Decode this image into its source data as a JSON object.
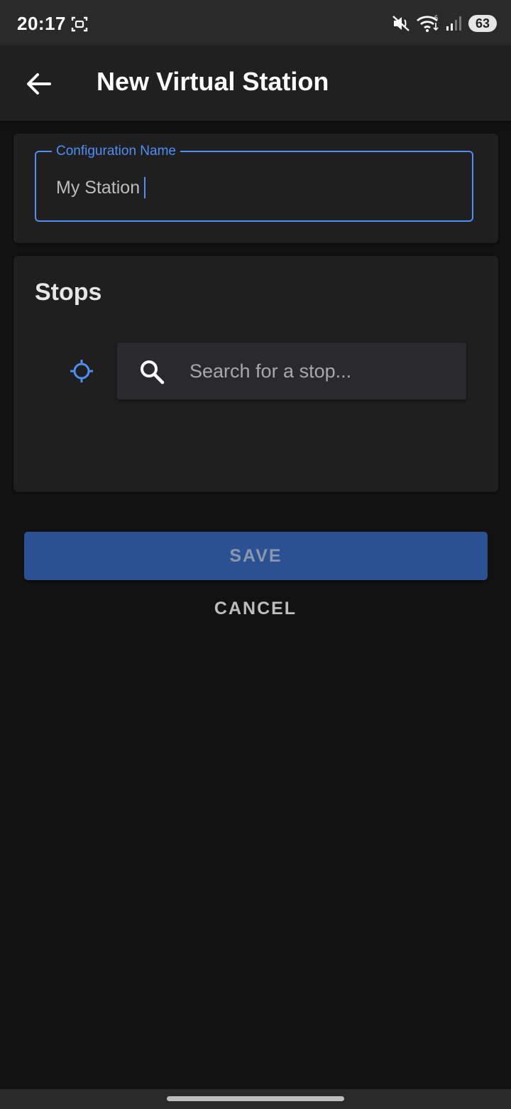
{
  "status_bar": {
    "time": "20:17",
    "battery_level": "63",
    "icons": [
      "screenshot-icon",
      "mute-icon",
      "wifi-icon",
      "signal-icon",
      "battery-icon"
    ],
    "network_badge": "6"
  },
  "app_bar": {
    "back_icon": "arrow-left-icon",
    "title": "New Virtual Station"
  },
  "config_name": {
    "label": "Configuration Name",
    "value": "My Station"
  },
  "stops": {
    "title": "Stops",
    "locate_icon": "crosshair-icon",
    "search_icon": "search-icon",
    "search_placeholder": "Search for a stop..."
  },
  "actions": {
    "save_label": "SAVE",
    "cancel_label": "CANCEL"
  },
  "colors": {
    "accent": "#4f8ef7",
    "save_button": "#2b5192",
    "background": "#121212",
    "card": "#1f1f1f"
  }
}
